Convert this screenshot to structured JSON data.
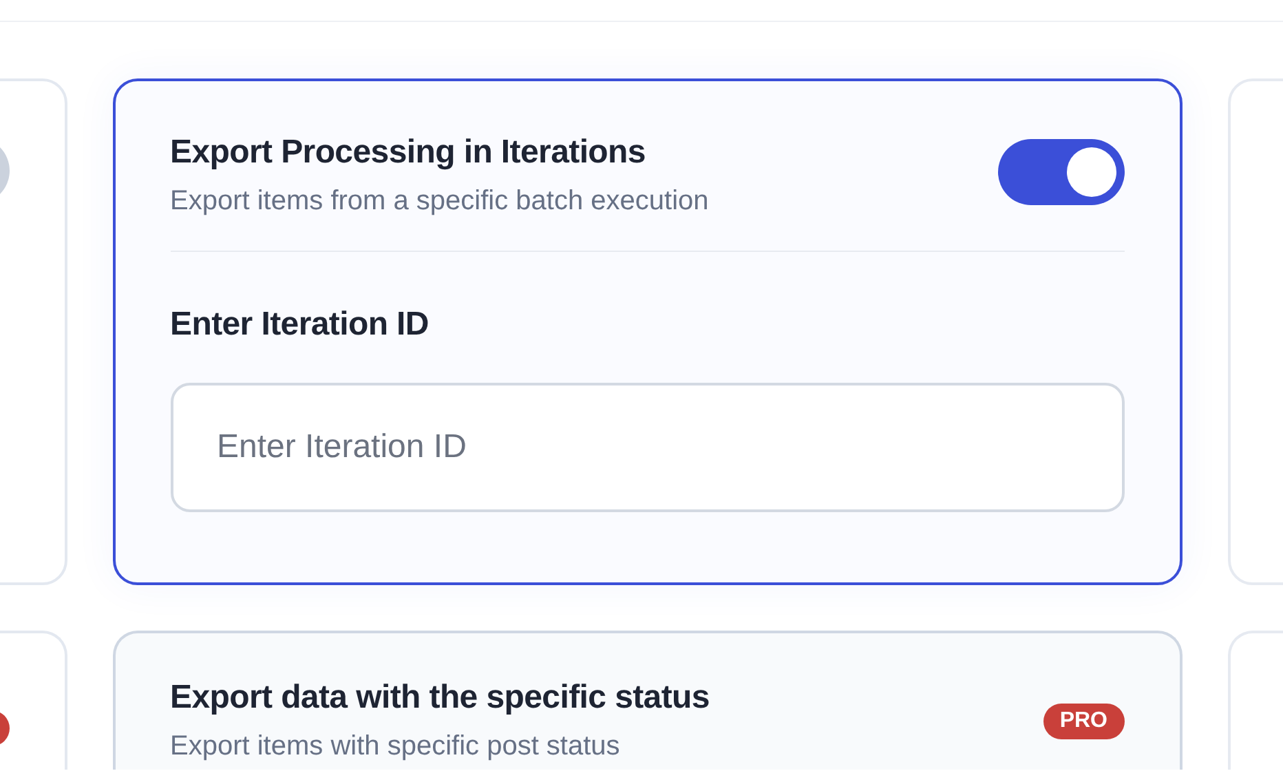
{
  "cards": [
    {
      "kind": "toggle_card",
      "toggle": {
        "on": false
      }
    },
    {
      "kind": "toggle_card",
      "selected": true,
      "title": "Export Processing in Iterations",
      "subtitle": "Export items from a specific batch execution",
      "toggle": {
        "on": true
      },
      "field_label": "Enter Iteration ID",
      "field": {
        "placeholder": "Enter Iteration ID"
      }
    },
    {
      "kind": "blank_card"
    },
    {
      "kind": "badge_card"
    },
    {
      "kind": "badge_card",
      "selected": false,
      "title": "Export data with the specific status",
      "subtitle": "Export items with specific post status",
      "badge": "PRO"
    },
    {
      "kind": "blank_card"
    }
  ]
}
